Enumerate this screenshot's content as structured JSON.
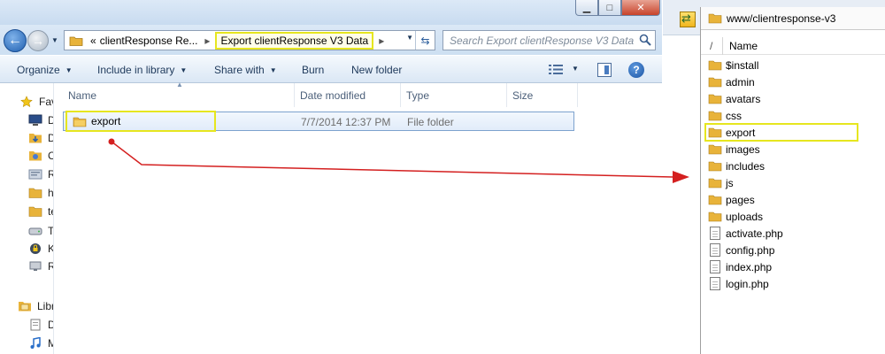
{
  "explorer": {
    "address": {
      "overflow": "«",
      "crumbs": [
        "clientResponse Re...",
        "Export clientResponse V3 Data"
      ]
    },
    "search": {
      "placeholder": "Search Export clientResponse V3 Data"
    },
    "toolbar": {
      "organize": "Organize",
      "include_in_library": "Include in library",
      "share_with": "Share with",
      "burn": "Burn",
      "new_folder": "New folder"
    },
    "navpane": {
      "items": [
        {
          "label": "Fav",
          "icon": "star-icon"
        },
        {
          "label": "D",
          "icon": "desktop-icon"
        },
        {
          "label": "D",
          "icon": "downloads-icon"
        },
        {
          "label": "C",
          "icon": "creative-cloud-icon"
        },
        {
          "label": "R",
          "icon": "recent-places-icon"
        },
        {
          "label": "h",
          "icon": "folder-icon"
        },
        {
          "label": "te",
          "icon": "folder-icon"
        },
        {
          "label": "T",
          "icon": "drive-icon"
        },
        {
          "label": "K",
          "icon": "lock-icon"
        },
        {
          "label": "R",
          "icon": "network-icon"
        },
        {
          "label": "Libr",
          "icon": "libraries-icon"
        },
        {
          "label": "D",
          "icon": "documents-icon"
        },
        {
          "label": "M",
          "icon": "music-icon"
        }
      ]
    },
    "columns": {
      "name": "Name",
      "date_modified": "Date modified",
      "type": "Type",
      "size": "Size"
    },
    "files": [
      {
        "name": "export",
        "date_modified": "7/7/2014 12:37 PM",
        "type": "File folder",
        "size": ""
      }
    ]
  },
  "ftp": {
    "path": "www/clientresponse-v3",
    "header": {
      "root": "/",
      "name": "Name"
    },
    "items": [
      {
        "name": "$install",
        "kind": "folder"
      },
      {
        "name": "admin",
        "kind": "folder"
      },
      {
        "name": "avatars",
        "kind": "folder"
      },
      {
        "name": "css",
        "kind": "folder"
      },
      {
        "name": "export",
        "kind": "folder",
        "highlighted": true
      },
      {
        "name": "images",
        "kind": "folder"
      },
      {
        "name": "includes",
        "kind": "folder"
      },
      {
        "name": "js",
        "kind": "folder"
      },
      {
        "name": "pages",
        "kind": "folder"
      },
      {
        "name": "uploads",
        "kind": "folder"
      },
      {
        "name": "activate.php",
        "kind": "file"
      },
      {
        "name": "config.php",
        "kind": "file"
      },
      {
        "name": "index.php",
        "kind": "file"
      },
      {
        "name": "login.php",
        "kind": "file"
      }
    ]
  },
  "colors": {
    "highlight": "#e6e61f",
    "arrow": "#d42020",
    "folder": "#e8b33a"
  }
}
